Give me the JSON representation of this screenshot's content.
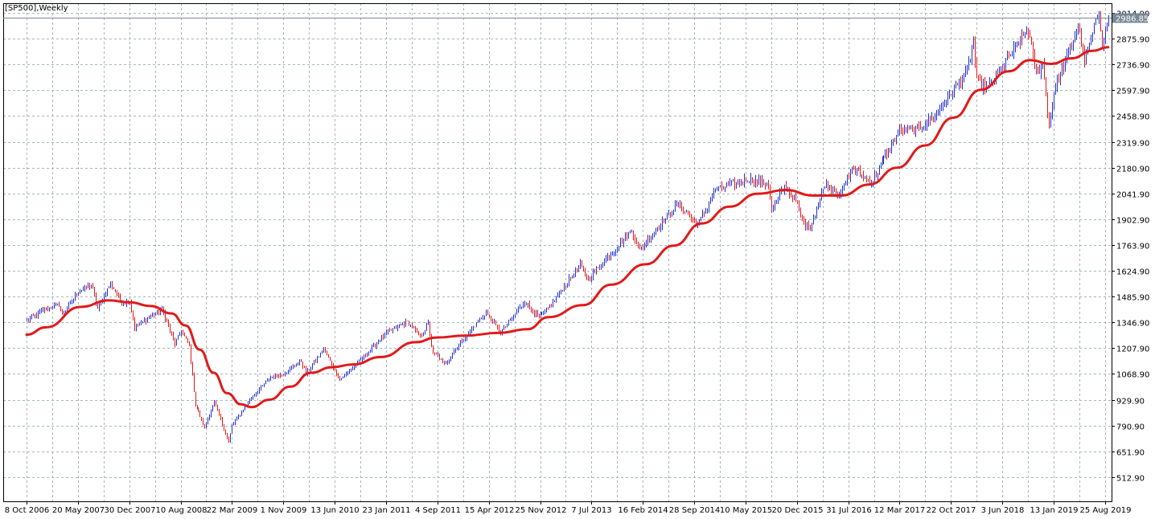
{
  "window": {
    "symbol_label": "[SP500],Weekly"
  },
  "colors": {
    "background": "#ffffff",
    "grid": "#a8b4c0",
    "bar_up": "#1f2fd0",
    "bar_down": "#e01818",
    "moving_average": "#e01a1a",
    "price_tag": "#7a8896",
    "axis": "#000000"
  },
  "chart_data": {
    "type": "ohlc-bars",
    "timeframe": "Weekly",
    "title": "[SP500],Weekly",
    "x_start": "2006-10-08",
    "x_end": "2019-09-08",
    "x_tick_labels": [
      "8 Oct 2006",
      "20 May 2007",
      "30 Dec 2007",
      "10 Aug 2008",
      "22 Mar 2009",
      "1 Nov 2009",
      "13 Jun 2010",
      "23 Jan 2011",
      "4 Sep 2011",
      "15 Apr 2012",
      "25 Nov 2012",
      "7 Jul 2013",
      "16 Feb 2014",
      "28 Sep 2014",
      "10 May 2015",
      "20 Dec 2015",
      "31 Jul 2016",
      "12 Mar 2017",
      "22 Oct 2017",
      "3 Jun 2018",
      "13 Jan 2019",
      "25 Aug 2019"
    ],
    "y_tick_labels": [
      "3014.90",
      "2875.90",
      "2736.90",
      "2597.90",
      "2458.90",
      "2319.90",
      "2180.90",
      "2041.90",
      "1902.90",
      "1763.90",
      "1624.90",
      "1485.90",
      "1346.90",
      "1207.90",
      "1068.90",
      "929.90",
      "790.90",
      "651.90",
      "512.90"
    ],
    "ylim": [
      384.9,
      3052.9
    ],
    "grid": true,
    "current_price_label": "2986.85",
    "current_price": 2986.85,
    "price_keypoints": [
      [
        "2006-10-08",
        1360
      ],
      [
        "2006-12-31",
        1420
      ],
      [
        "2007-02-25",
        1440
      ],
      [
        "2007-03-11",
        1390
      ],
      [
        "2007-05-20",
        1510
      ],
      [
        "2007-07-15",
        1550
      ],
      [
        "2007-08-12",
        1420
      ],
      [
        "2007-10-07",
        1560
      ],
      [
        "2007-11-25",
        1450
      ],
      [
        "2007-12-30",
        1460
      ],
      [
        "2008-01-20",
        1320
      ],
      [
        "2008-05-18",
        1420
      ],
      [
        "2008-07-13",
        1230
      ],
      [
        "2008-08-10",
        1300
      ],
      [
        "2008-09-14",
        1220
      ],
      [
        "2008-10-12",
        900
      ],
      [
        "2008-11-23",
        780
      ],
      [
        "2009-01-04",
        920
      ],
      [
        "2009-03-08",
        700
      ],
      [
        "2009-03-22",
        790
      ],
      [
        "2009-06-14",
        940
      ],
      [
        "2009-09-06",
        1050
      ],
      [
        "2009-11-01",
        1070
      ],
      [
        "2010-01-17",
        1140
      ],
      [
        "2010-02-07",
        1070
      ],
      [
        "2010-04-25",
        1200
      ],
      [
        "2010-07-04",
        1040
      ],
      [
        "2010-09-05",
        1110
      ],
      [
        "2011-01-23",
        1290
      ],
      [
        "2011-04-24",
        1350
      ],
      [
        "2011-06-19",
        1270
      ],
      [
        "2011-07-24",
        1340
      ],
      [
        "2011-08-14",
        1170
      ],
      [
        "2011-09-04",
        1170
      ],
      [
        "2011-10-02",
        1120
      ],
      [
        "2011-12-25",
        1260
      ],
      [
        "2012-04-01",
        1400
      ],
      [
        "2012-06-03",
        1290
      ],
      [
        "2012-09-16",
        1460
      ],
      [
        "2012-11-18",
        1370
      ],
      [
        "2012-12-30",
        1420
      ],
      [
        "2013-05-19",
        1660
      ],
      [
        "2013-06-23",
        1580
      ],
      [
        "2013-09-15",
        1700
      ],
      [
        "2013-12-29",
        1840
      ],
      [
        "2014-02-02",
        1740
      ],
      [
        "2014-07-20",
        1990
      ],
      [
        "2014-10-12",
        1870
      ],
      [
        "2014-12-28",
        2060
      ],
      [
        "2015-05-17",
        2120
      ],
      [
        "2015-08-16",
        2090
      ],
      [
        "2015-08-30",
        1950
      ],
      [
        "2015-10-25",
        2080
      ],
      [
        "2015-12-13",
        2000
      ],
      [
        "2016-01-17",
        1880
      ],
      [
        "2016-02-14",
        1860
      ],
      [
        "2016-04-17",
        2090
      ],
      [
        "2016-06-26",
        2040
      ],
      [
        "2016-08-14",
        2180
      ],
      [
        "2016-11-06",
        2100
      ],
      [
        "2017-01-29",
        2290
      ],
      [
        "2017-03-12",
        2380
      ],
      [
        "2017-05-21",
        2380
      ],
      [
        "2017-08-13",
        2460
      ],
      [
        "2017-12-31",
        2700
      ],
      [
        "2018-01-28",
        2860
      ],
      [
        "2018-02-11",
        2640
      ],
      [
        "2018-04-01",
        2610
      ],
      [
        "2018-08-26",
        2880
      ],
      [
        "2018-09-23",
        2920
      ],
      [
        "2018-10-28",
        2680
      ],
      [
        "2018-11-25",
        2740
      ],
      [
        "2018-12-23",
        2400
      ],
      [
        "2019-01-13",
        2590
      ],
      [
        "2019-04-28",
        2940
      ],
      [
        "2019-05-26",
        2760
      ],
      [
        "2019-07-28",
        3020
      ],
      [
        "2019-08-11",
        2860
      ],
      [
        "2019-09-08",
        2990
      ]
    ],
    "moving_average_keypoints": [
      [
        "2006-10-08",
        1280
      ],
      [
        "2007-01-01",
        1320
      ],
      [
        "2007-06-01",
        1430
      ],
      [
        "2007-10-01",
        1465
      ],
      [
        "2008-01-01",
        1455
      ],
      [
        "2008-04-01",
        1435
      ],
      [
        "2008-07-01",
        1395
      ],
      [
        "2008-09-01",
        1330
      ],
      [
        "2008-11-01",
        1200
      ],
      [
        "2009-01-01",
        1075
      ],
      [
        "2009-03-01",
        965
      ],
      [
        "2009-05-01",
        905
      ],
      [
        "2009-06-15",
        890
      ],
      [
        "2009-09-01",
        930
      ],
      [
        "2009-12-01",
        1000
      ],
      [
        "2010-03-01",
        1075
      ],
      [
        "2010-06-01",
        1105
      ],
      [
        "2010-09-01",
        1120
      ],
      [
        "2011-01-01",
        1160
      ],
      [
        "2011-06-01",
        1240
      ],
      [
        "2011-09-01",
        1265
      ],
      [
        "2012-01-01",
        1275
      ],
      [
        "2012-06-01",
        1290
      ],
      [
        "2012-10-01",
        1310
      ],
      [
        "2013-01-01",
        1375
      ],
      [
        "2013-06-01",
        1440
      ],
      [
        "2013-10-01",
        1550
      ],
      [
        "2014-03-01",
        1660
      ],
      [
        "2014-07-01",
        1760
      ],
      [
        "2014-11-01",
        1880
      ],
      [
        "2015-03-01,",
        1970
      ],
      [
        "2015-07-01",
        2040
      ],
      [
        "2015-11-01",
        2060
      ],
      [
        "2016-03-01",
        2030
      ],
      [
        "2016-07-01",
        2030
      ],
      [
        "2016-11-01",
        2090
      ],
      [
        "2017-03-01",
        2180
      ],
      [
        "2017-07-01",
        2300
      ],
      [
        "2017-11-01",
        2450
      ],
      [
        "2018-03-01",
        2600
      ],
      [
        "2018-07-01",
        2700
      ],
      [
        "2018-10-01",
        2760
      ],
      [
        "2019-01-01",
        2740
      ],
      [
        "2019-04-01",
        2770
      ],
      [
        "2019-07-01",
        2810
      ],
      [
        "2019-09-08",
        2830
      ]
    ]
  }
}
